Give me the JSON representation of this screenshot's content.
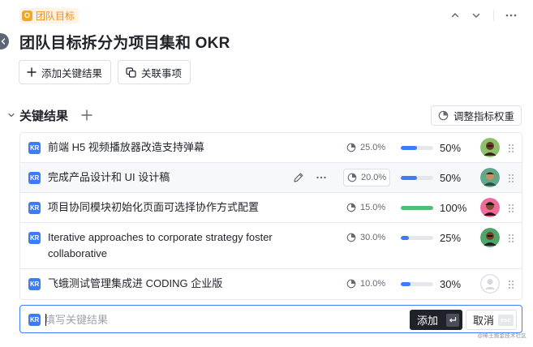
{
  "header": {
    "tag_icon_letter": "O",
    "tag_label": "团队目标",
    "icons": [
      "chevron-up-icon",
      "chevron-down-icon",
      "more-icon"
    ]
  },
  "title": "团队目标拆分为项目集和 OKR",
  "actions": {
    "add_kr_label": "添加关键结果",
    "link_items_label": "关联事项"
  },
  "section": {
    "title": "关键结果",
    "adjust_weight_label": "调整指标权重"
  },
  "kr_badge": "KR",
  "key_results": [
    {
      "text": "前端 H5 视频播放器改造支持弹幕",
      "weight": "25.0%",
      "progress": 0.5,
      "percent": "50%",
      "avatar": "avatar-1"
    },
    {
      "text": "完成产品设计和 UI 设计稿",
      "weight": "20.0%",
      "progress": 0.5,
      "percent": "50%",
      "avatar": "avatar-2",
      "hover": true
    },
    {
      "text": "项目协同模块初始化页面可选择协作方式配置",
      "weight": "15.0%",
      "progress": 1.0,
      "percent": "100%",
      "avatar": "avatar-3"
    },
    {
      "text": "Iterative approaches to corporate strategy foster",
      "text2": "collaborative",
      "weight": "30.0%",
      "progress": 0.25,
      "percent": "25%",
      "avatar": "avatar-4"
    },
    {
      "text": "飞蛾测试管理集成进 CODING 企业版",
      "weight": "10.0%",
      "progress": 0.3,
      "percent": "30%",
      "avatar": "avatar-empty"
    }
  ],
  "add_row": {
    "placeholder": "填写关键结果",
    "add_label": "添加",
    "cancel_label": "取消",
    "esc_label": "esc"
  },
  "watermark": "@稀土掘金技术社区",
  "colors": {
    "accent": "#3e7bfa",
    "done": "#4fbf74",
    "tag": "#f28d1a"
  }
}
